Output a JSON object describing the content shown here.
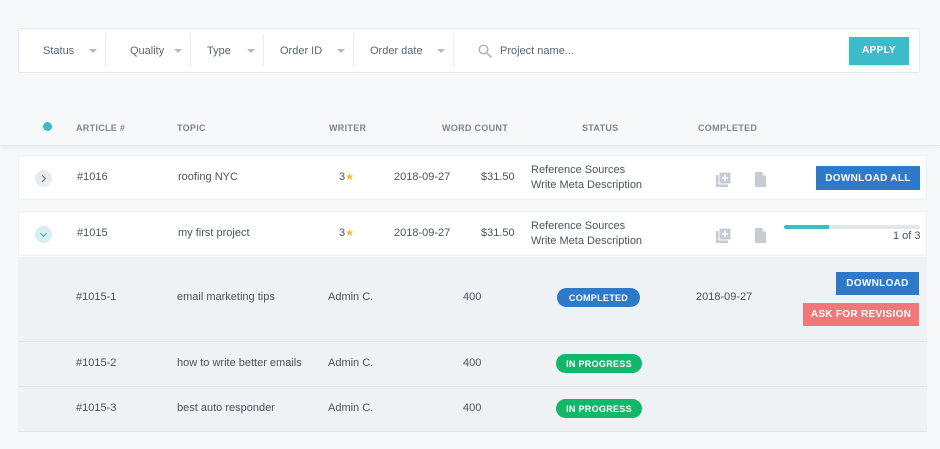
{
  "filters": {
    "status": "Status",
    "quality": "Quality",
    "type": "Type",
    "order_id": "Order ID",
    "order_date": "Order date",
    "search_placeholder": "Project name...",
    "apply": "APPLY"
  },
  "table_header": {
    "article": "ARTICLE #",
    "topic": "TOPIC",
    "writer": "WRITER",
    "word_count": "WORD COUNT",
    "status": "STATUS",
    "completed": "COMPLETED"
  },
  "orders": [
    {
      "id": "#1016",
      "topic": "roofing NYC",
      "writer_rating": "3",
      "date": "2018-09-27",
      "price": "$31.50",
      "status_line1": "Reference Sources",
      "status_line2": "Write Meta Description",
      "action": "DOWNLOAD ALL",
      "expanded": false
    },
    {
      "id": "#1015",
      "topic": "my first project",
      "writer_rating": "3",
      "date": "2018-09-27",
      "price": "$31.50",
      "status_line1": "Reference Sources",
      "status_line2": "Write Meta Description",
      "progress_text": "1 of 3",
      "progress_fraction": 0.333,
      "expanded": true
    }
  ],
  "articles": [
    {
      "id": "#1015-1",
      "topic": "email marketing tips",
      "writer": "Admin C.",
      "word_count": "400",
      "status": "COMPLETED",
      "completed_date": "2018-09-27",
      "download": "DOWNLOAD",
      "revision": "ASK FOR REVISION"
    },
    {
      "id": "#1015-2",
      "topic": "how to write better emails",
      "writer": "Admin C.",
      "word_count": "400",
      "status": "IN PROGRESS"
    },
    {
      "id": "#1015-3",
      "topic": "best auto responder",
      "writer": "Admin C.",
      "word_count": "400",
      "status": "IN PROGRESS"
    }
  ],
  "colors": {
    "accent": "#3bbcc8",
    "primary": "#2e79c8",
    "success": "#12b76a",
    "danger": "#f0787a",
    "star": "#f6b928"
  },
  "icons": {
    "add_files": "add-files-icon",
    "document": "document-icon",
    "search": "search-icon",
    "star": "star-icon"
  }
}
